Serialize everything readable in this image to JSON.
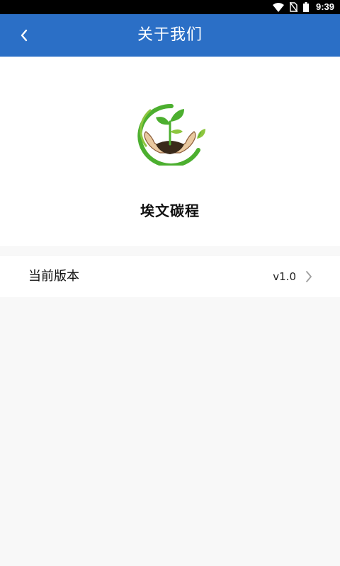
{
  "status_bar": {
    "time": "9:39",
    "icons": [
      "wifi-icon",
      "no-sim-icon",
      "battery-icon"
    ]
  },
  "app_bar": {
    "back_icon": "chevron-left-icon",
    "title": "关于我们",
    "color": "#2b6fc6"
  },
  "about": {
    "logo_icon": "seedling-in-hands-logo",
    "app_name": "埃文碳程"
  },
  "version_row": {
    "label": "当前版本",
    "value": "v1.0",
    "chevron_icon": "chevron-right-icon"
  },
  "colors": {
    "page_background": "#f8f8f8",
    "logo_green": "#4caf2f",
    "logo_light_green": "#8dc63f"
  }
}
